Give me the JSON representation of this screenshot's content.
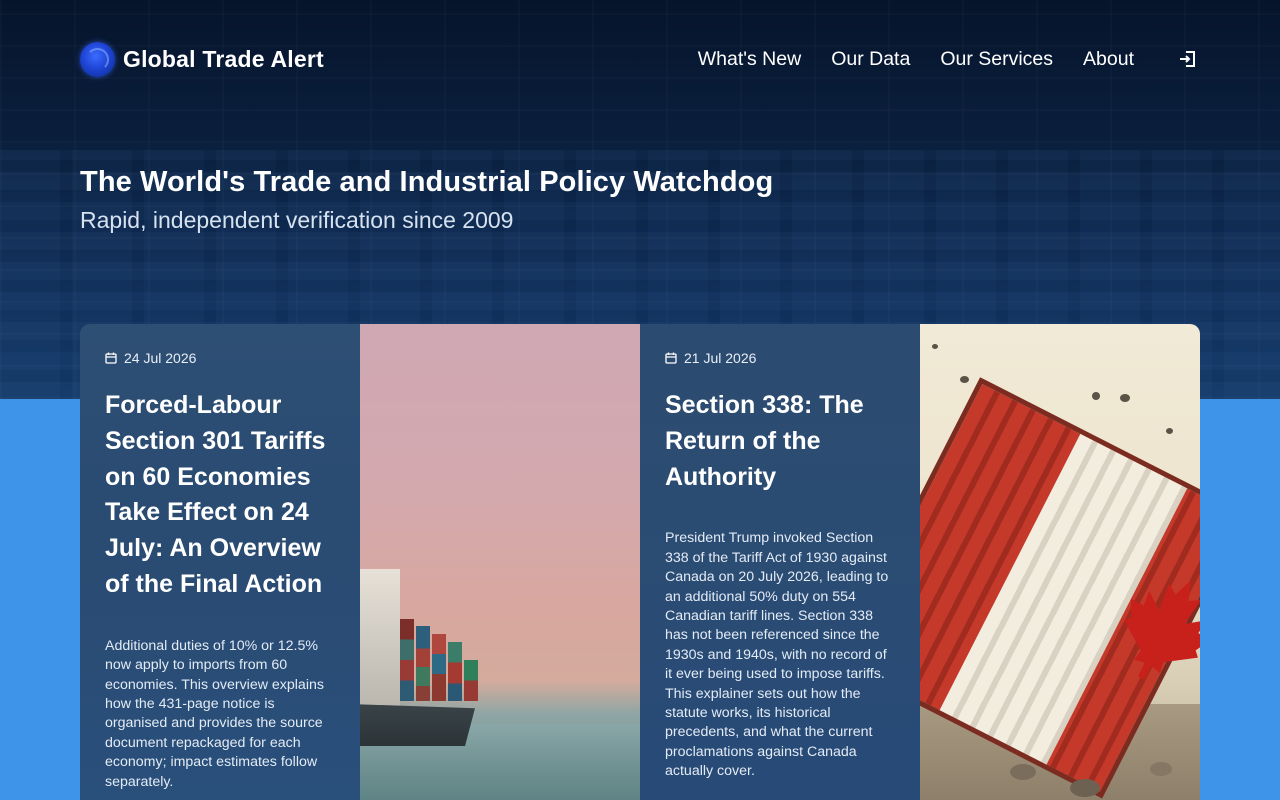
{
  "brand": {
    "name": "Global Trade Alert"
  },
  "nav": {
    "items": [
      "What's New",
      "Our Data",
      "Our Services",
      "About"
    ]
  },
  "hero": {
    "title": "The World's Trade and Industrial Policy Watchdog",
    "subtitle": "Rapid, independent verification since 2009"
  },
  "articles": [
    {
      "date": "24 Jul 2026",
      "title": "Forced-Labour Section 301 Tariffs on 60 Economies Take Effect on 24 July: An Overview of the Final Action",
      "description": "Additional duties of 10% or 12.5% now apply to imports from 60 economies. This overview explains how the 431-page notice is organised and provides the source document repackaged for each economy; impact estimates follow separately."
    },
    {
      "date": "21 Jul 2026",
      "title": "Section 338: The Return of the Authority",
      "description": "President Trump invoked Section 338 of the Tariff Act of 1930 against Canada on 20 July 2026, leading to an additional 50% duty on 554 Canadian tariff lines. Section 338 has not been referenced since the 1930s and 1940s, with no record of it ever being used to impose tariffs. This explainer sets out how the statute works, its historical precedents, and what the current proclamations against Canada actually cover."
    }
  ],
  "colors": {
    "hero_dark": "#0a1f3d",
    "page_blue": "#3d94e8",
    "card_panel": "#2d4e74"
  }
}
